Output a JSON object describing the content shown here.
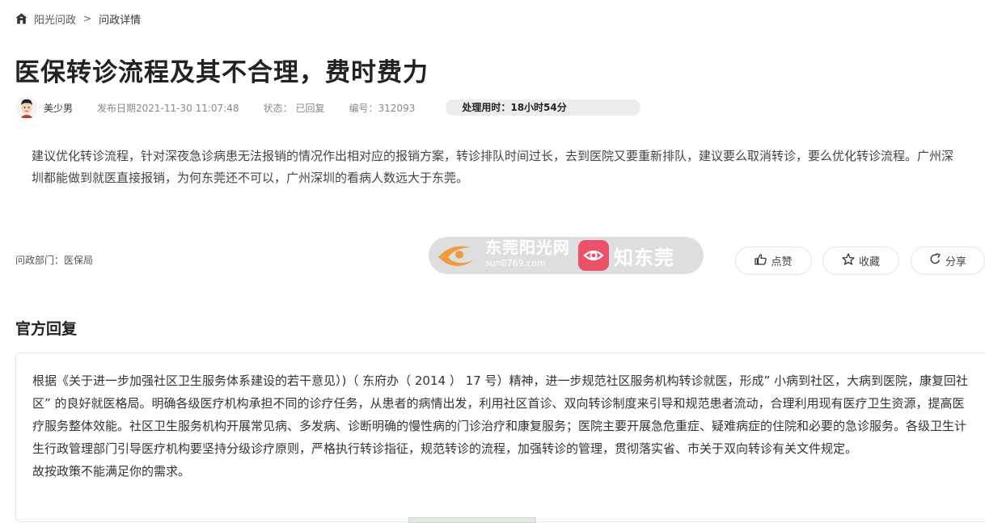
{
  "breadcrumb": {
    "home_icon": "home-icon",
    "root": "阳光问政",
    "separator": ">",
    "current": "问政详情"
  },
  "title": "医保转诊流程及其不合理，费时费力",
  "meta": {
    "author": "美少男",
    "date_label": "发布日期",
    "date": "2021-11-30 11:07:48",
    "status_label": "状态：",
    "status": "已回复",
    "number_label": "编号：",
    "number": "312093",
    "time_label": "处理用时：",
    "time": "18小时54分"
  },
  "question": "建议优化转诊流程，针对深夜急诊病患无法报销的情况作出相对应的报销方案，转诊排队时间过长，去到医院又要重新排队，建议要么取消转诊，要么优化转诊流程。广州深圳都能做到就医直接报销，为何东莞还不可以，广州深圳的看病人数远大于东莞。",
  "department": {
    "label": "问政部门：",
    "name": "医保局"
  },
  "watermark": {
    "site_name": "东莞阳光网",
    "site_domain": "sun0769.com",
    "brand": "知东莞"
  },
  "actions": {
    "like": "点赞",
    "favorite": "收藏",
    "share": "分享"
  },
  "reply": {
    "heading": "官方回复",
    "paragraphs": [
      "根据《关于进一步加强社区卫生服务体系建设的若干意见）)（ 东府办（ 2014 ） 17 号）精神，进一步规范社区服务机构转诊就医，形成” 小病到社区，大病到医院，康复回社区” 的良好就医格局。明确各级医疗机构承担不同的诊疗任务，从患者的病情出发，利用社区首诊、双向转诊制度来引导和规范患者流动，合理利用现有医疗卫生资源，提高医疗服务整体效能。社区卫生服务机构开展常见病、多发病、诊断明确的慢性病的门诊治疗和康复服务；医院主要开展急危重症、疑难病症的住院和必要的急诊服务。各级卫生计生行政管理部门引导医疗机构要坚持分级诊疗原则，严格执行转诊指征，规范转诊的流程，加强转诊的管理，贯彻落实省、市关于双向转诊有关文件规定。",
      "故按政策不能满足你的需求。"
    ]
  },
  "colors": {
    "accent_red": "#e8334f",
    "watermark_orange": "#f08a1d",
    "pill_bg": "#ececec"
  }
}
